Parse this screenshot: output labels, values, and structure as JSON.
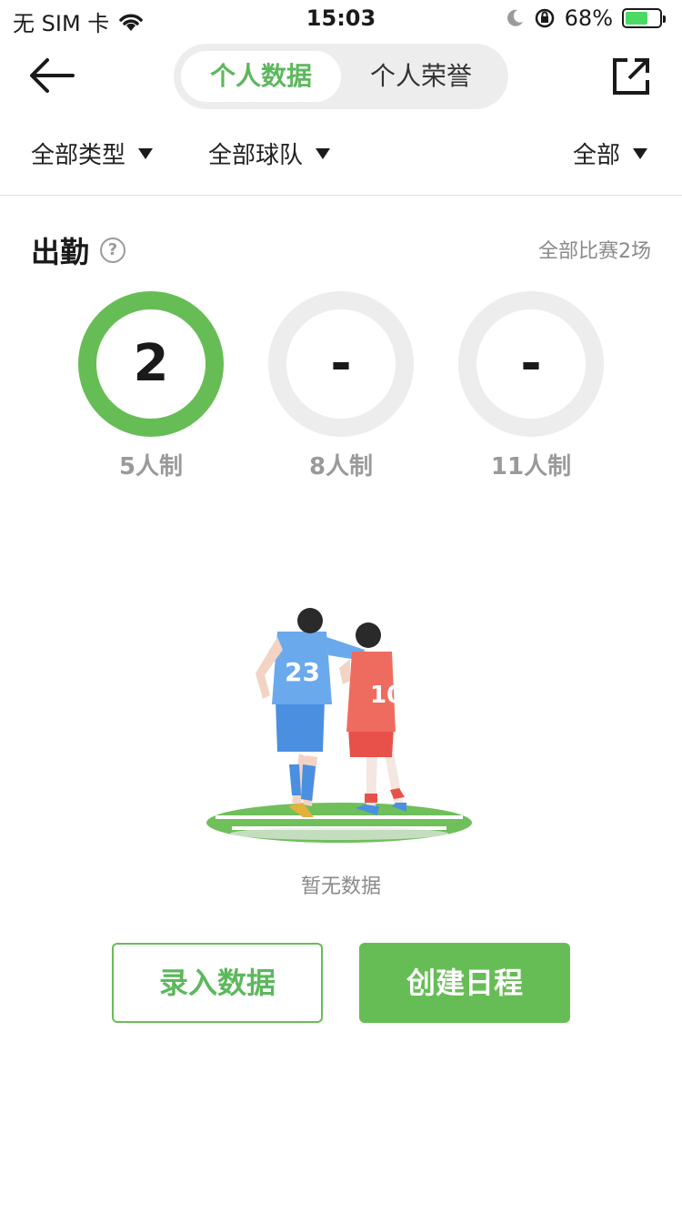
{
  "status_bar": {
    "carrier": "无 SIM 卡",
    "time": "15:03",
    "battery_percent": "68%",
    "battery_level": 0.68,
    "icons": [
      "wifi-icon",
      "moon-icon",
      "orientation-lock-icon",
      "battery-charging-icon"
    ]
  },
  "nav": {
    "tabs": [
      {
        "label": "个人数据",
        "active": true
      },
      {
        "label": "个人荣誉",
        "active": false
      }
    ],
    "icons": [
      "back-arrow-icon",
      "share-icon"
    ]
  },
  "filters": {
    "type": "全部类型",
    "team": "全部球队",
    "scope": "全部"
  },
  "attendance": {
    "title": "出勤",
    "help_icon": "question-circle-icon",
    "total": "全部比赛2场",
    "stats": [
      {
        "value": "2",
        "label": "5人制",
        "active": true
      },
      {
        "value": "-",
        "label": "8人制",
        "active": false
      },
      {
        "value": "-",
        "label": "11人制",
        "active": false
      }
    ]
  },
  "empty_state": {
    "text": "暂无数据",
    "illustration": "two-football-players-illustration",
    "jerseys": [
      "23",
      "10"
    ]
  },
  "actions": {
    "enter_data": "录入数据",
    "create_schedule": "创建日程"
  },
  "colors": {
    "accent": "#67bd55",
    "ring_inactive": "#ededed",
    "muted_text": "#8a8a8a"
  }
}
